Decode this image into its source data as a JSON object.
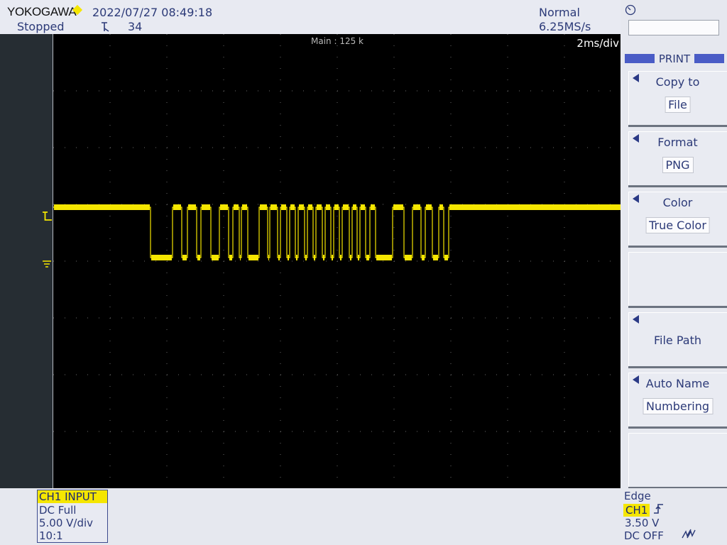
{
  "header": {
    "brand": "YOKOGAWA",
    "datetime": "2022/07/27 08:49:18",
    "status": "Stopped",
    "acq_count": "34",
    "trigger_mode": "Normal",
    "sample_rate": "6.25MS/s"
  },
  "screen": {
    "main_label": "Main : 125 k",
    "time_div": "2ms/div",
    "trace_color": "#f5e600"
  },
  "menu": {
    "title": "PRINT",
    "softkeys": [
      {
        "label": "Copy to",
        "value": "File"
      },
      {
        "label": "Format",
        "value": "PNG"
      },
      {
        "label": "Color",
        "value": "True Color"
      },
      {
        "label": ""
      },
      {
        "label": "File Path"
      },
      {
        "label": "Auto Name",
        "value": "Numbering"
      },
      {
        "label": ""
      }
    ]
  },
  "channel": {
    "title": "CH1 INPUT",
    "coupling": "DC Full",
    "vdiv": "5.00 V/div",
    "probe": "10:1"
  },
  "trigger": {
    "type": "Edge",
    "source": "CH1",
    "level": "3.50 V",
    "hf_reject": "DC OFF"
  }
}
